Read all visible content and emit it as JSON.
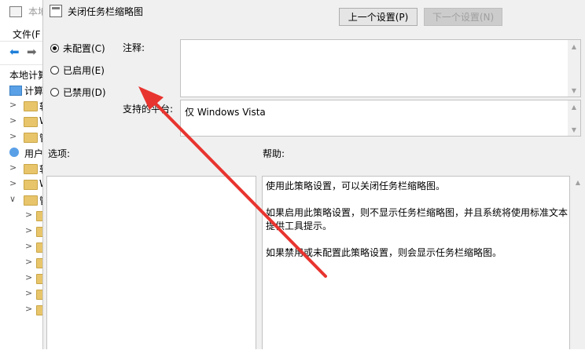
{
  "background_window": {
    "title": "本地",
    "menu_file": "文件(F",
    "tree": [
      {
        "label": "本地计算",
        "kind": "root"
      },
      {
        "label": "计算",
        "kind": "pc"
      },
      {
        "label": "软",
        "kind": "folder"
      },
      {
        "label": "W",
        "kind": "folder"
      },
      {
        "label": "管",
        "kind": "folder"
      },
      {
        "label": "用户",
        "kind": "user"
      },
      {
        "label": "软",
        "kind": "folder"
      },
      {
        "label": "W",
        "kind": "folder"
      },
      {
        "label": "管",
        "kind": "folder"
      }
    ]
  },
  "dialog": {
    "title": "关闭任务栏缩略图",
    "prev_button": "上一个设置(P)",
    "next_button": "下一个设置(N)",
    "radios": [
      {
        "label": "未配置(C)",
        "checked": true
      },
      {
        "label": "已启用(E)",
        "checked": false
      },
      {
        "label": "已禁用(D)",
        "checked": false
      }
    ],
    "note_label": "注释:",
    "note_value": "",
    "supported_label": "支持的平台:",
    "supported_value": "仅 Windows Vista",
    "options_label": "选项:",
    "help_label": "帮助:",
    "help_paragraphs": [
      "使用此策略设置，可以关闭任务栏缩略图。",
      "如果启用此策略设置，则不显示任务栏缩略图，并且系统将使用标准文本提供工具提示。",
      "如果禁用或未配置此策略设置，则会显示任务栏缩略图。"
    ]
  },
  "colors": {
    "dialog_bg": "#f0f0f0",
    "annotation_red": "#e8342f",
    "accent_blue": "#1f7fd9"
  },
  "icons": {
    "back": "back-arrow-icon",
    "forward": "forward-arrow-icon",
    "scroll_up": "scroll-up-icon",
    "scroll_down": "scroll-down-icon"
  }
}
